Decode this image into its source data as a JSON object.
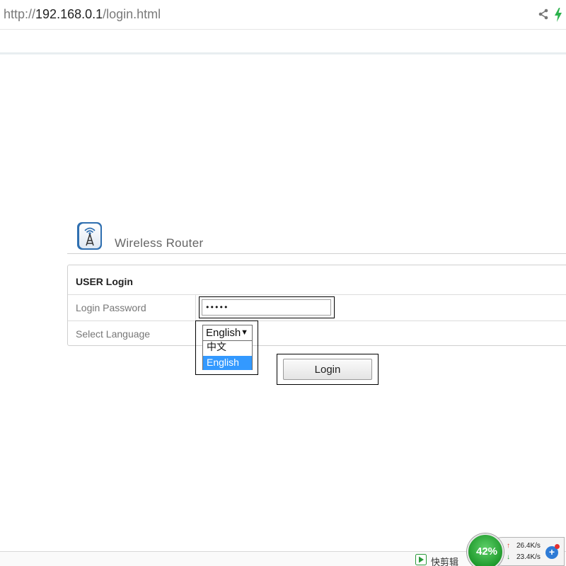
{
  "browser": {
    "url_prefix": "http://",
    "url_host": "192.168.0.1",
    "url_path": "/login.html",
    "icons": [
      "share-icon",
      "bolt-icon"
    ]
  },
  "router": {
    "title": "Wireless Router",
    "logo_icon": "antenna-tower-icon"
  },
  "login_panel": {
    "heading": "USER Login",
    "password_label": "Login Password",
    "password_value": "•••••",
    "language_label": "Select Language",
    "language_selected": "English",
    "language_options": [
      "中文",
      "English"
    ],
    "login_button": "Login"
  },
  "status_bar": {
    "clip_label": "快剪辑",
    "gauge_percent": "42%",
    "upload_rate": "26.4K/s",
    "download_rate": "23.4K/s"
  },
  "colors": {
    "selected_option_bg": "#3399ff",
    "gauge_green": "#1f9a2c",
    "bolt_green": "#2bb24c"
  }
}
